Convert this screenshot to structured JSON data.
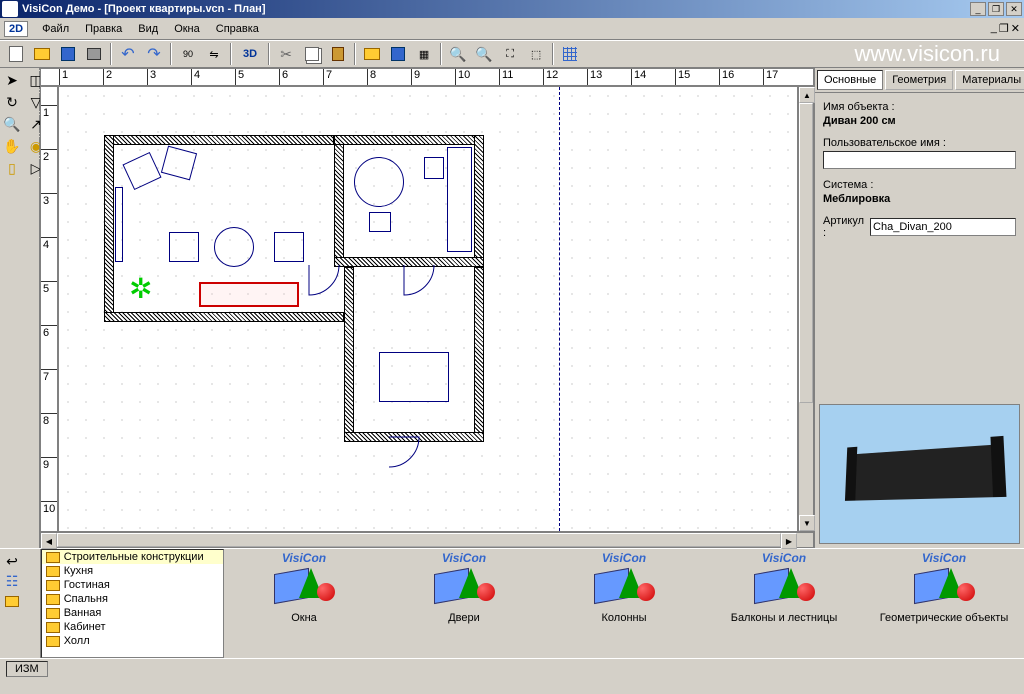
{
  "titlebar": {
    "title": "VisiCon Демо - [Проект квартиры.vcn - План]"
  },
  "menu": {
    "mode2d": "2D",
    "file": "Файл",
    "edit": "Правка",
    "view": "Вид",
    "windows": "Окна",
    "help": "Справка"
  },
  "toolbar": {
    "mode3d": "3D",
    "rot90": "90",
    "watermark": "www.visicon.ru"
  },
  "ruler": {
    "h": [
      "1",
      "2",
      "3",
      "4",
      "5",
      "6",
      "7",
      "8",
      "9",
      "10",
      "11",
      "12",
      "13",
      "14",
      "15",
      "16",
      "17"
    ],
    "v": [
      "1",
      "2",
      "3",
      "4",
      "5",
      "6",
      "7",
      "8",
      "9",
      "10"
    ]
  },
  "rightpanel": {
    "tabs": {
      "basic": "Основные",
      "geometry": "Геометрия",
      "materials": "Материалы"
    },
    "obj_name_label": "Имя объекта :",
    "obj_name_value": "Диван 200 см",
    "user_name_label": "Пользовательское имя :",
    "user_name_value": "",
    "system_label": "Система :",
    "system_value": "Меблировка",
    "article_label": "Артикул :",
    "article_value": "Cha_Divan_200"
  },
  "tree": {
    "items": [
      "Строительные конструкции",
      "Кухня",
      "Гостиная",
      "Спальня",
      "Ванная",
      "Кабинет",
      "Холл"
    ]
  },
  "library": {
    "brand": "VisiCon",
    "items": [
      "Окна",
      "Двери",
      "Колонны",
      "Балконы и лестницы",
      "Геометрические объекты"
    ]
  },
  "statusbar": {
    "mode": "ИЗМ"
  }
}
